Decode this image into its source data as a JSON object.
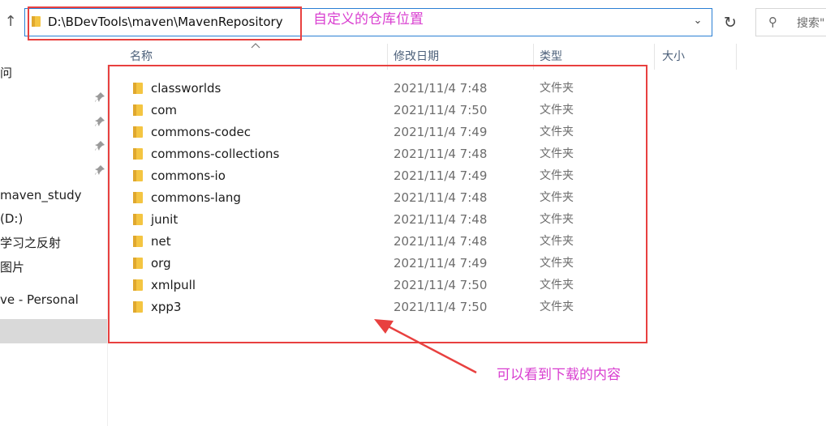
{
  "address_bar": {
    "path": "D:\\BDevTools\\maven\\MavenRepository",
    "dropdown_icon": "chevron-down-icon",
    "refresh_icon": "refresh-icon"
  },
  "search": {
    "placeholder": "搜索\""
  },
  "columns": {
    "name": "名称",
    "modified": "修改日期",
    "type": "类型",
    "size": "大小"
  },
  "sidebar": {
    "items": [
      {
        "label": "问"
      },
      {
        "label": "maven_study"
      },
      {
        "label": "(D:)"
      },
      {
        "label": "学习之反射"
      },
      {
        "label": "图片"
      },
      {
        "label": "ve - Personal"
      }
    ]
  },
  "files": [
    {
      "name": "classworlds",
      "date": "2021/11/4 7:48",
      "type": "文件夹"
    },
    {
      "name": "com",
      "date": "2021/11/4 7:50",
      "type": "文件夹"
    },
    {
      "name": "commons-codec",
      "date": "2021/11/4 7:49",
      "type": "文件夹"
    },
    {
      "name": "commons-collections",
      "date": "2021/11/4 7:48",
      "type": "文件夹"
    },
    {
      "name": "commons-io",
      "date": "2021/11/4 7:49",
      "type": "文件夹"
    },
    {
      "name": "commons-lang",
      "date": "2021/11/4 7:48",
      "type": "文件夹"
    },
    {
      "name": "junit",
      "date": "2021/11/4 7:48",
      "type": "文件夹"
    },
    {
      "name": "net",
      "date": "2021/11/4 7:48",
      "type": "文件夹"
    },
    {
      "name": "org",
      "date": "2021/11/4 7:49",
      "type": "文件夹"
    },
    {
      "name": "xmlpull",
      "date": "2021/11/4 7:50",
      "type": "文件夹"
    },
    {
      "name": "xpp3",
      "date": "2021/11/4 7:50",
      "type": "文件夹"
    }
  ],
  "annotations": {
    "path_note": "自定义的仓库位置",
    "content_note": "可以看到下载的内容",
    "color": "#e8403f",
    "text_color": "#d93fd0"
  },
  "colors": {
    "folder": "#f4c542",
    "address_border": "#2a7fd4"
  }
}
